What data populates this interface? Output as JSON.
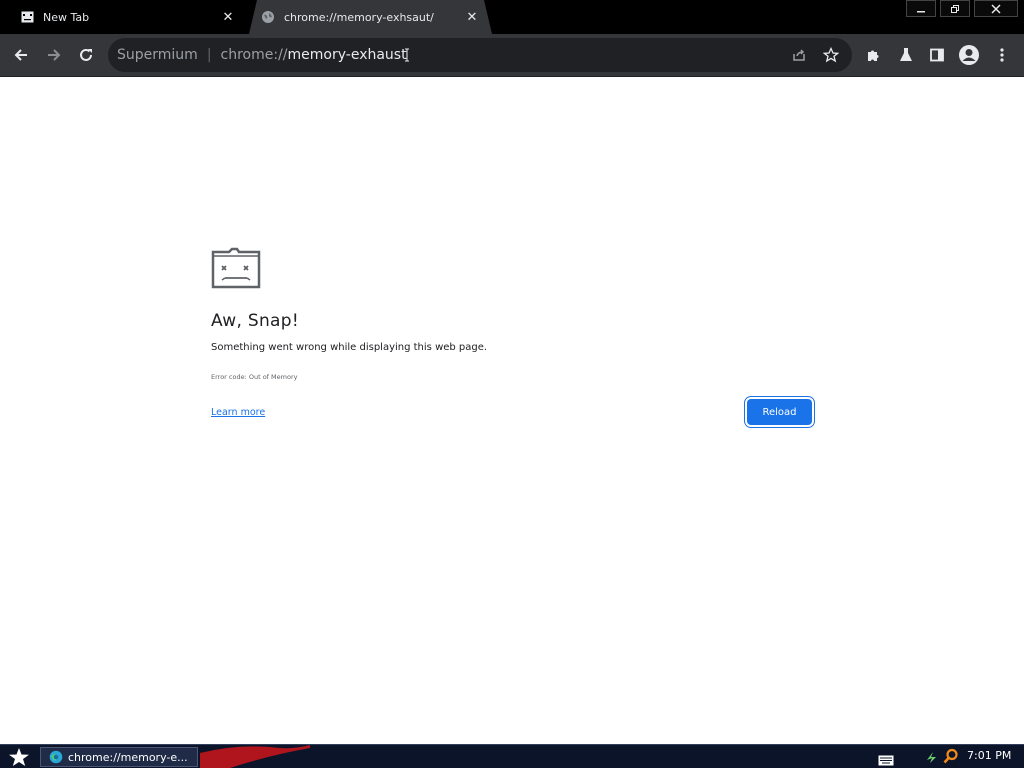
{
  "tabs": [
    {
      "title": "New Tab",
      "favicon": "sad-tab-icon",
      "active": false
    },
    {
      "title": "chrome://memory-exhsaut/",
      "favicon": "globe-icon",
      "active": true
    }
  ],
  "window_controls": {
    "minimize": "minimize-icon",
    "restore": "restore-icon",
    "close": "close-icon"
  },
  "omnibox": {
    "chip": "Supermium",
    "separator": "|",
    "url_scheme": "chrome://",
    "url_rest": "memory-exhaust"
  },
  "content": {
    "heading": "Aw, Snap!",
    "message": "Something went wrong while displaying this web page.",
    "error_code": "Error code: Out of Memory",
    "learn_more": "Learn more",
    "reload": "Reload"
  },
  "taskbar": {
    "task_label": "chrome://memory-e...",
    "clock": "7:01 PM"
  },
  "colors": {
    "accent": "#1a73e8",
    "toolbar": "#35363a",
    "omnibox": "#202124",
    "tabstrip": "#000000",
    "taskbar": "#0b1428"
  }
}
